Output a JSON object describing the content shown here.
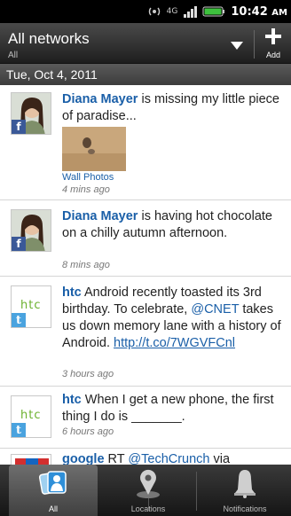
{
  "status_bar": {
    "network": "4G",
    "time": "10:42",
    "ampm": "AM",
    "icons": [
      "hotspot-icon",
      "4g-icon",
      "signal-icon",
      "battery-icon"
    ]
  },
  "header": {
    "title": "All networks",
    "subtitle": "All",
    "add_label": "Add"
  },
  "date_label": "Tue, Oct 4, 2011",
  "posts": [
    {
      "name": "Diana Mayer",
      "text": " is missing my little piece of paradise...",
      "photo_caption": "Wall Photos",
      "time": "4 mins ago",
      "network": "facebook"
    },
    {
      "name": "Diana Mayer",
      "text": " is having hot chocolate on a chilly autumn afternoon.",
      "time": "8 mins ago",
      "network": "facebook"
    },
    {
      "name": "htc",
      "text_a": " Android recently toasted its 3rd birthday. To celebrate, ",
      "mention": "@CNET",
      "text_b": " takes us down memory lane with a history of Android. ",
      "url": "http://t.co/7WGVFCnl",
      "time": "3 hours ago",
      "network": "twitter"
    },
    {
      "name": "htc",
      "text": " When I get a new phone, the first thing I do is _______.",
      "time": "6 hours ago",
      "network": "twitter"
    },
    {
      "name": "google",
      "text_a": " RT ",
      "mention": "@TechCrunch",
      "text_b": " via",
      "network": "twitter"
    }
  ],
  "tabs": [
    {
      "label": "All",
      "icon": "friends-stream-icon",
      "selected": true
    },
    {
      "label": "Locations",
      "icon": "map-pin-icon",
      "selected": false
    },
    {
      "label": "Notifications",
      "icon": "bell-icon",
      "selected": false
    }
  ],
  "colors": {
    "link": "#1a5fa8",
    "facebook": "#3b5998",
    "twitter": "#4aa3df",
    "htc_green": "#6bb12e"
  }
}
